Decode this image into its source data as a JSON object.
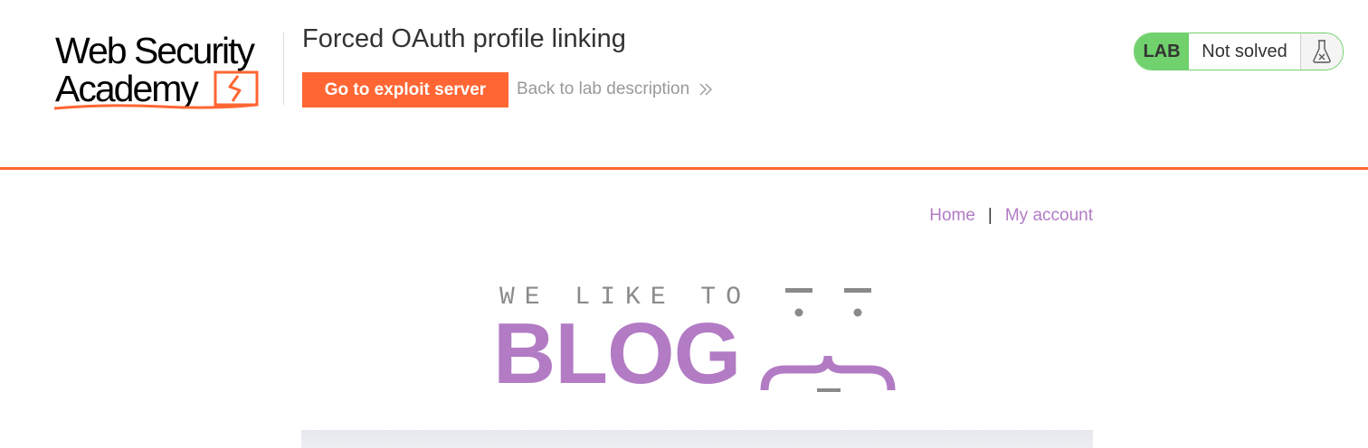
{
  "logo": {
    "line1": "Web Security",
    "line2": "Academy"
  },
  "lab": {
    "title": "Forced OAuth profile linking",
    "exploit_button": "Go to exploit server",
    "back_link": "Back to lab description",
    "back_icon": "double-chevron-right-icon",
    "status_tag": "LAB",
    "status": "Not solved",
    "status_icon": "flask-icon"
  },
  "nav": {
    "home": "Home",
    "separator": "|",
    "my_account": "My account"
  },
  "blog_logo": {
    "tagline": "WE LIKE TO",
    "word": "BLOG"
  },
  "colors": {
    "accent": "#ff6633",
    "brand_purple": "#b27bc4",
    "lab_green": "#70d16d"
  }
}
